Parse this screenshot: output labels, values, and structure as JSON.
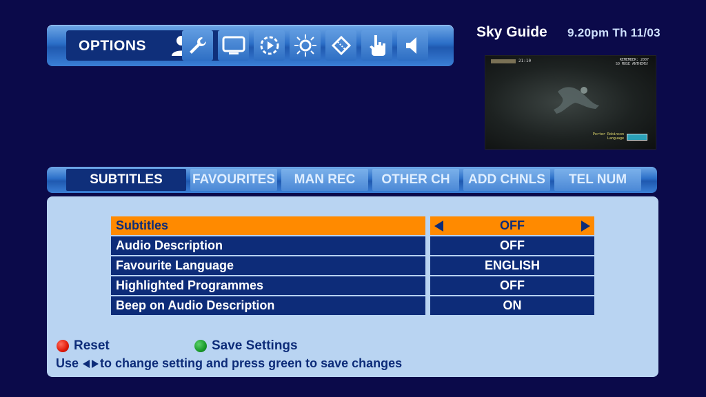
{
  "header": {
    "options_label": "OPTIONS",
    "guide_title": "Sky Guide",
    "datetime": "9.20pm Th 11/03"
  },
  "toolbar_icons": [
    "user-icon",
    "wrench-icon",
    "tv-icon",
    "dial-icon",
    "sun-icon",
    "ticket-icon",
    "hand-pointer-icon",
    "speaker-icon"
  ],
  "preview": {
    "hud_left": "21:10",
    "hud_right_1": "REMEMBER: 2007",
    "hud_right_2": "SO MUSE ANTHEMS!",
    "hud_bottom_1": "Porter Robinson",
    "hud_bottom_2": "Language"
  },
  "tabs": [
    "SUBTITLES",
    "FAVOURITES",
    "MAN REC",
    "OTHER CH",
    "ADD CHNLS",
    "TEL NUM"
  ],
  "active_tab": "SUBTITLES",
  "settings": [
    {
      "label": "Subtitles",
      "value": "OFF",
      "selected": true
    },
    {
      "label": "Audio Description",
      "value": "OFF",
      "selected": false
    },
    {
      "label": "Favourite Language",
      "value": "ENGLISH",
      "selected": false
    },
    {
      "label": "Highlighted Programmes",
      "value": "OFF",
      "selected": false
    },
    {
      "label": "Beep on Audio Description",
      "value": "ON",
      "selected": false
    }
  ],
  "footer": {
    "reset_label": "Reset",
    "save_label": "Save Settings",
    "hint_prefix": "Use",
    "hint_suffix": "to change setting and press green to save changes"
  },
  "colors": {
    "background": "#0b0a4a",
    "bar_blue": "#2b6fc8",
    "row_navy": "#0d2c79",
    "highlight_orange": "#ff8a00",
    "panel_light": "#b9d4f2",
    "key_red": "#e01a0a",
    "key_green": "#1a9a2a"
  }
}
